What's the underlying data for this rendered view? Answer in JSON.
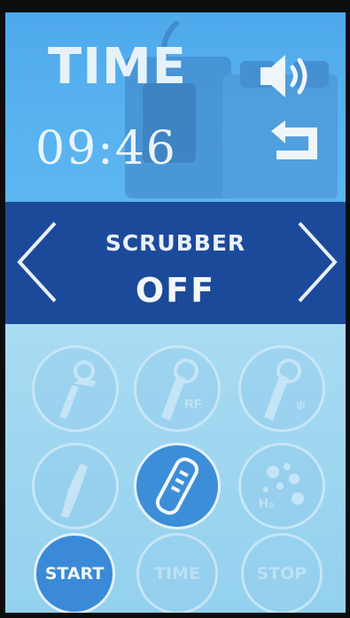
{
  "header": {
    "title": "TIME",
    "clock": "09:46"
  },
  "banner": {
    "mode_name": "SCRUBBER",
    "mode_state": "OFF"
  },
  "tools": [
    {
      "name": "tweezer-tool",
      "tag": ""
    },
    {
      "name": "rf-tool",
      "tag": "RF"
    },
    {
      "name": "cold-tool",
      "tag": "❄"
    },
    {
      "name": "pen-tool",
      "tag": ""
    },
    {
      "name": "scrubber-tool",
      "tag": ""
    },
    {
      "name": "hydrogen-tool",
      "tag": "H₂"
    }
  ],
  "controls": {
    "start": "START",
    "time": "TIME",
    "stop": "STOP"
  },
  "colors": {
    "header": "#58b2f0",
    "banner": "#1c4a9a",
    "panel": "#a9dbf2",
    "active": "#3a8ad8"
  }
}
